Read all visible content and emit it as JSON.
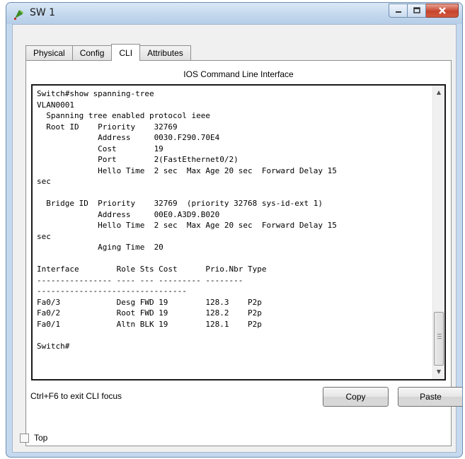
{
  "window": {
    "title": "SW 1"
  },
  "tabs": [
    "Physical",
    "Config",
    "CLI",
    "Attributes"
  ],
  "panel": {
    "title": "IOS Command Line Interface"
  },
  "terminal": {
    "lines": [
      "Switch#show spanning-tree",
      "VLAN0001",
      "  Spanning tree enabled protocol ieee",
      "  Root ID    Priority    32769",
      "             Address     0030.F290.70E4",
      "             Cost        19",
      "             Port        2(FastEthernet0/2)",
      "             Hello Time  2 sec  Max Age 20 sec  Forward Delay 15",
      "sec",
      "",
      "  Bridge ID  Priority    32769  (priority 32768 sys-id-ext 1)",
      "             Address     00E0.A3D9.B020",
      "             Hello Time  2 sec  Max Age 20 sec  Forward Delay 15",
      "sec",
      "             Aging Time  20",
      "",
      "Interface        Role Sts Cost      Prio.Nbr Type",
      "---------------- ---- --- --------- --------",
      "--------------------------------",
      "Fa0/3            Desg FWD 19        128.3    P2p",
      "Fa0/2            Root FWD 19        128.2    P2p",
      "Fa0/1            Altn BLK 19        128.1    P2p",
      "",
      "Switch#"
    ]
  },
  "footer": {
    "hint": "Ctrl+F6 to exit CLI focus",
    "copy_label": "Copy",
    "paste_label": "Paste"
  },
  "top_checkbox": {
    "label": "Top",
    "checked": false
  }
}
